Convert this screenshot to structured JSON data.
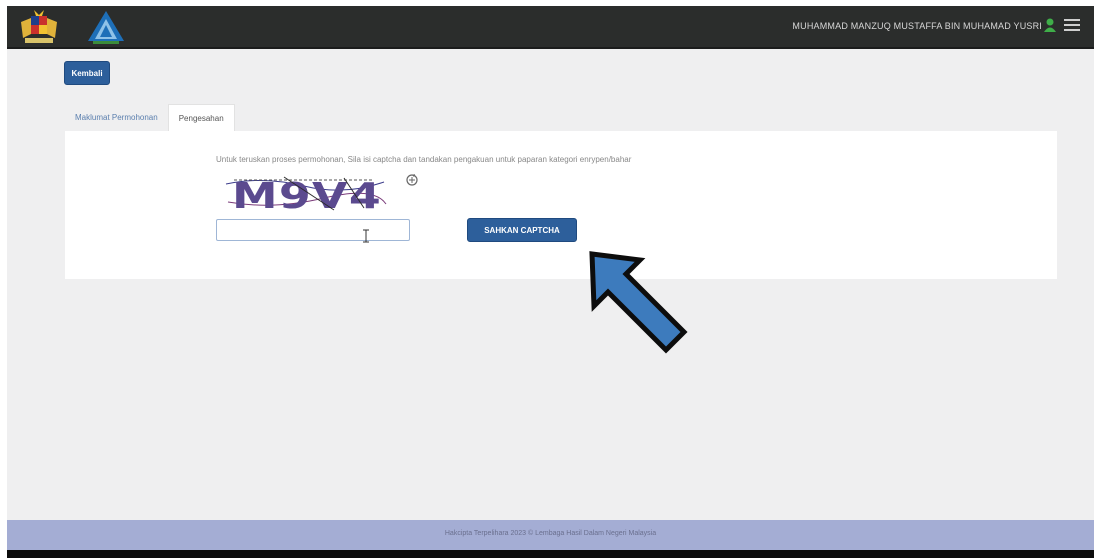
{
  "header": {
    "username": "MUHAMMAD MANZUQ MUSTAFFA BIN MUHAMAD YUSRI",
    "crest_icon": "malaysia-crest-icon",
    "logo_icon": "lhdn-logo-icon",
    "user_icon": "user-icon",
    "menu_icon": "hamburger-menu-icon"
  },
  "actions": {
    "back_label": "Kembali"
  },
  "tabs": [
    {
      "label": "Maklumat Permohonan",
      "active": false
    },
    {
      "label": "Pengesahan",
      "active": true
    }
  ],
  "verification": {
    "instruction": "Untuk teruskan proses permohonan, Sila isi captcha dan tandakan pengakuan untuk paparan kategori enrypen/bahar",
    "captcha_text": "M9V4",
    "refresh_icon": "refresh-icon",
    "input_value": "",
    "input_placeholder": "",
    "submit_label": "SAHKAN CAPTCHA"
  },
  "footer": {
    "text": "Hakcipta Terpelihara 2023 © Lembaga Hasil Dalam Negeri Malaysia"
  },
  "colors": {
    "topbar": "#2b2d2c",
    "primary_button": "#2d5f9b",
    "footer": "#a4add4",
    "arrow": "#3d7bbd"
  }
}
